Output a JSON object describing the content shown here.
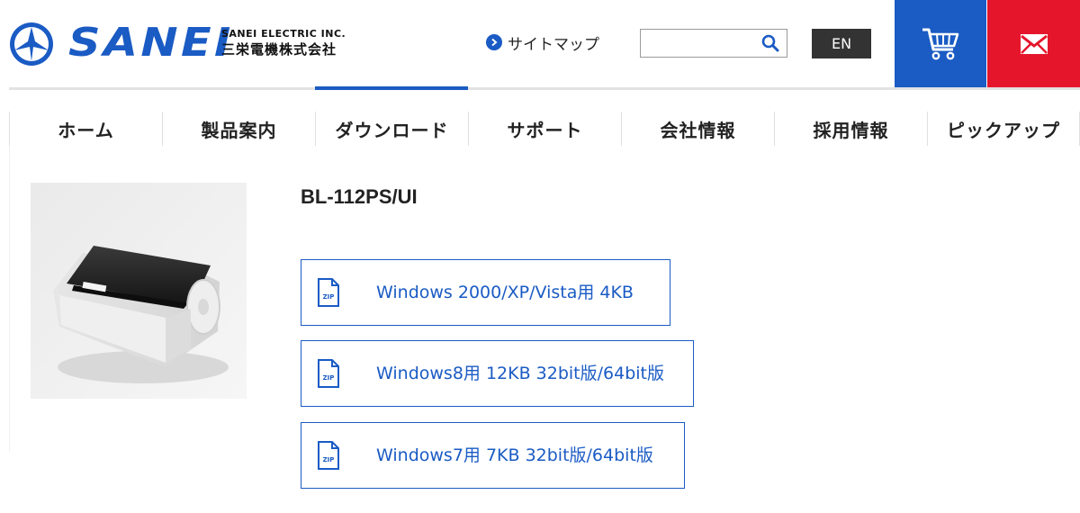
{
  "brand": {
    "name": "SANEI",
    "company_en": "SANEI ELECTRIC INC.",
    "company_ja": "三栄電機株式会社",
    "color": "#1a5bc4"
  },
  "header": {
    "sitemap_label": "サイトマップ",
    "search_placeholder": "",
    "search_value": "",
    "lang_label": "EN",
    "cart_icon": "cart-icon",
    "mail_icon": "mail-icon",
    "cart_color": "#1a5bc4",
    "mail_color": "#e5162c"
  },
  "nav": {
    "items": [
      {
        "label": "ホーム"
      },
      {
        "label": "製品案内"
      },
      {
        "label": "ダウンロード"
      },
      {
        "label": "サポート"
      },
      {
        "label": "会社情報"
      },
      {
        "label": "採用情報"
      },
      {
        "label": "ピックアップ"
      }
    ],
    "active_index": 2
  },
  "product": {
    "title": "BL-112PS/UI",
    "downloads": [
      {
        "label": "Windows 2000/XP/Vista用 4KB",
        "icon": "zip-icon"
      },
      {
        "label": "Windows8用 12KB 32bit版/64bit版",
        "icon": "zip-icon"
      },
      {
        "label": "Windows7用 7KB 32bit版/64bit版",
        "icon": "zip-icon"
      }
    ]
  },
  "zip_icon_text": "ZIP"
}
